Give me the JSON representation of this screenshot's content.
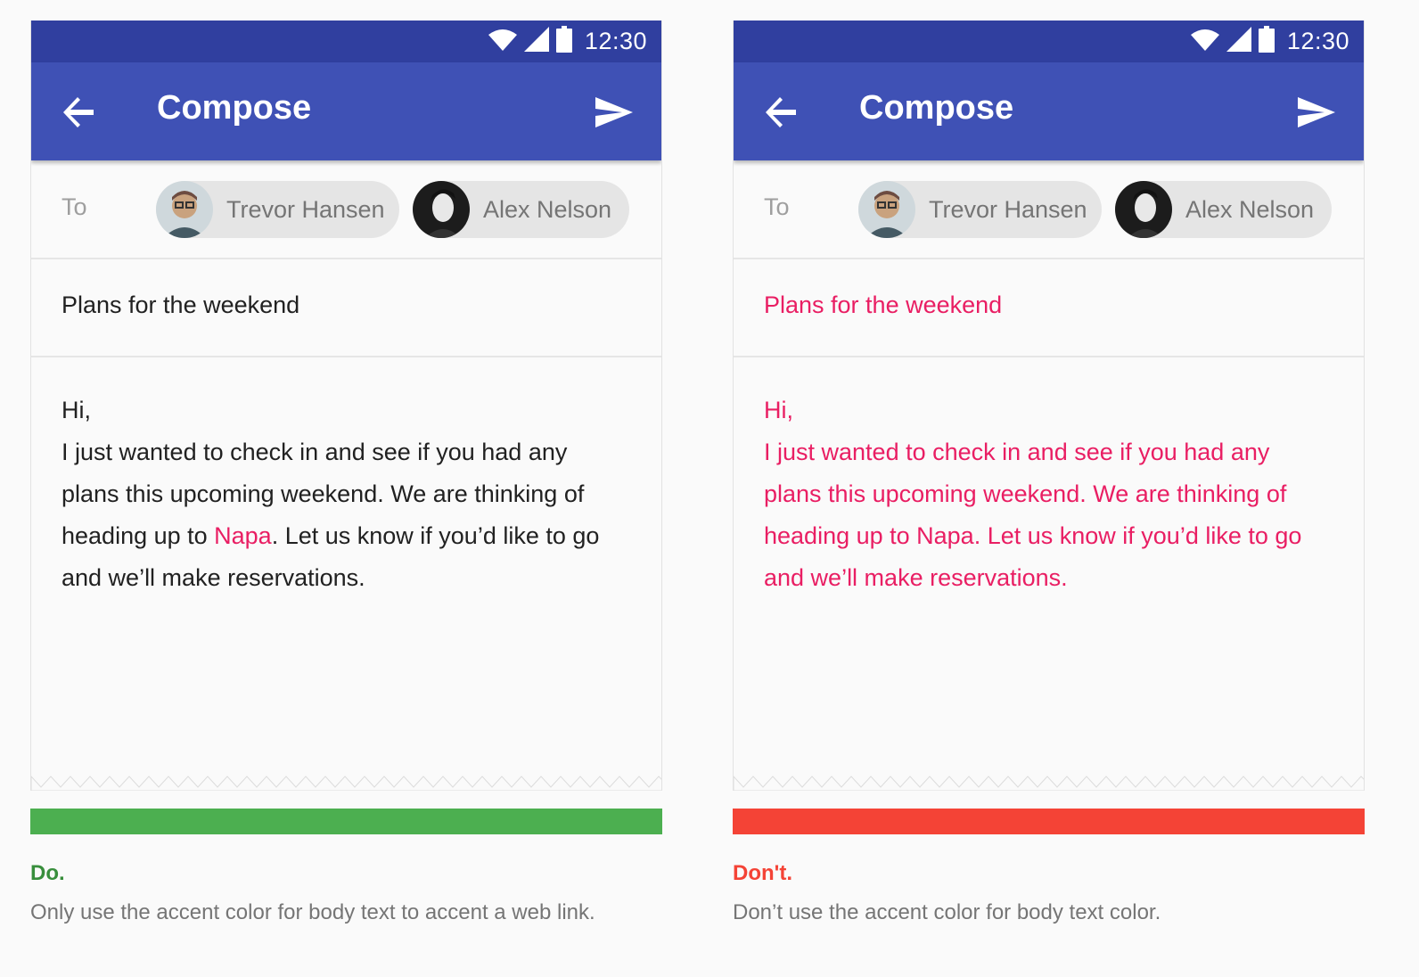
{
  "colors": {
    "primary": "#3f51b5",
    "primary_dark": "#303f9f",
    "accent": "#e91e63",
    "do": "#4caf50",
    "dont": "#f44336"
  },
  "status_bar": {
    "time": "12:30",
    "icons": [
      "wifi-icon",
      "signal-icon",
      "battery-icon"
    ]
  },
  "app_bar": {
    "title": "Compose",
    "back_icon": "arrow-back-icon",
    "send_icon": "send-icon"
  },
  "recipients": {
    "to_label": "To",
    "chips": [
      {
        "name": "Trevor Hansen"
      },
      {
        "name": "Alex Nelson"
      }
    ]
  },
  "subject": "Plans for the weekend",
  "body": {
    "greeting": "Hi,",
    "line1": "I just wanted to check in and see if you had any",
    "line2": "plans this upcoming weekend. We are thinking of",
    "line3_pre": "heading up to ",
    "link": "Napa",
    "line3_post": ". Let us know if you’d like to go",
    "line4": "and we’ll make reservations."
  },
  "examples": {
    "do": {
      "verdict": "Do.",
      "caption": "Only use the accent color for body text to accent a web link."
    },
    "dont": {
      "verdict": "Don't.",
      "caption": "Don’t use the accent color for body text color."
    }
  }
}
